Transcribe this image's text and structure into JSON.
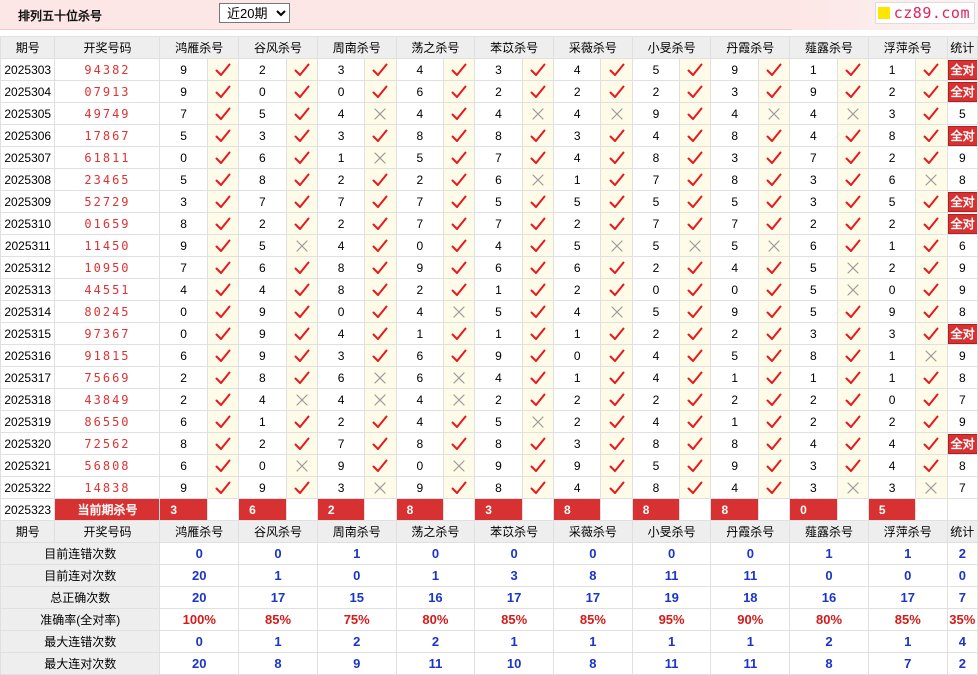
{
  "header": {
    "title": "排列五十位杀号",
    "range_selected": "近20期",
    "logo_text": "cz89.com"
  },
  "columns": {
    "period": "期号",
    "numbers": "开奖号码",
    "experts": [
      "鸿雁杀号",
      "谷风杀号",
      "周南杀号",
      "荡之杀号",
      "苯苡杀号",
      "采薇杀号",
      "小旻杀号",
      "丹霞杀号",
      "薤露杀号",
      "浮萍杀号"
    ],
    "stats": "统计"
  },
  "rows": [
    {
      "period": "2025303",
      "numbers": "94382",
      "kills": [
        9,
        2,
        3,
        4,
        3,
        4,
        5,
        9,
        1,
        1
      ],
      "ok": [
        1,
        1,
        1,
        1,
        1,
        1,
        1,
        1,
        1,
        1
      ],
      "stat": "全对"
    },
    {
      "period": "2025304",
      "numbers": "07913",
      "kills": [
        9,
        0,
        0,
        6,
        2,
        2,
        2,
        3,
        9,
        2
      ],
      "ok": [
        1,
        1,
        1,
        1,
        1,
        1,
        1,
        1,
        1,
        1
      ],
      "stat": "全对"
    },
    {
      "period": "2025305",
      "numbers": "49749",
      "kills": [
        7,
        5,
        4,
        4,
        4,
        4,
        9,
        4,
        4,
        3
      ],
      "ok": [
        1,
        1,
        0,
        1,
        0,
        0,
        1,
        0,
        0,
        1
      ],
      "stat": "5"
    },
    {
      "period": "2025306",
      "numbers": "17867",
      "kills": [
        5,
        3,
        3,
        8,
        8,
        3,
        4,
        8,
        4,
        8
      ],
      "ok": [
        1,
        1,
        1,
        1,
        1,
        1,
        1,
        1,
        1,
        1
      ],
      "stat": "全对"
    },
    {
      "period": "2025307",
      "numbers": "61811",
      "kills": [
        0,
        6,
        1,
        5,
        7,
        4,
        8,
        3,
        7,
        2
      ],
      "ok": [
        1,
        1,
        0,
        1,
        1,
        1,
        1,
        1,
        1,
        1
      ],
      "stat": "9"
    },
    {
      "period": "2025308",
      "numbers": "23465",
      "kills": [
        5,
        8,
        2,
        2,
        6,
        1,
        7,
        8,
        3,
        6
      ],
      "ok": [
        1,
        1,
        1,
        1,
        0,
        1,
        1,
        1,
        1,
        0
      ],
      "stat": "8"
    },
    {
      "period": "2025309",
      "numbers": "52729",
      "kills": [
        3,
        7,
        7,
        7,
        5,
        5,
        5,
        5,
        3,
        5
      ],
      "ok": [
        1,
        1,
        1,
        1,
        1,
        1,
        1,
        1,
        1,
        1
      ],
      "stat": "全对"
    },
    {
      "period": "2025310",
      "numbers": "01659",
      "kills": [
        8,
        2,
        2,
        7,
        7,
        2,
        7,
        7,
        2,
        2
      ],
      "ok": [
        1,
        1,
        1,
        1,
        1,
        1,
        1,
        1,
        1,
        1
      ],
      "stat": "全对"
    },
    {
      "period": "2025311",
      "numbers": "11450",
      "kills": [
        9,
        5,
        4,
        0,
        4,
        5,
        5,
        5,
        6,
        1
      ],
      "ok": [
        1,
        0,
        1,
        1,
        1,
        0,
        0,
        0,
        1,
        1
      ],
      "stat": "6"
    },
    {
      "period": "2025312",
      "numbers": "10950",
      "kills": [
        7,
        6,
        8,
        9,
        6,
        6,
        2,
        4,
        5,
        2
      ],
      "ok": [
        1,
        1,
        1,
        1,
        1,
        1,
        1,
        1,
        0,
        1
      ],
      "stat": "9"
    },
    {
      "period": "2025313",
      "numbers": "44551",
      "kills": [
        4,
        4,
        8,
        2,
        1,
        2,
        0,
        0,
        5,
        0
      ],
      "ok": [
        1,
        1,
        1,
        1,
        1,
        1,
        1,
        1,
        0,
        1
      ],
      "stat": "9"
    },
    {
      "period": "2025314",
      "numbers": "80245",
      "kills": [
        0,
        9,
        0,
        4,
        5,
        4,
        5,
        9,
        5,
        9
      ],
      "ok": [
        1,
        1,
        1,
        0,
        1,
        0,
        1,
        1,
        1,
        1
      ],
      "stat": "8"
    },
    {
      "period": "2025315",
      "numbers": "97367",
      "kills": [
        0,
        9,
        4,
        1,
        1,
        1,
        2,
        2,
        3,
        3
      ],
      "ok": [
        1,
        1,
        1,
        1,
        1,
        1,
        1,
        1,
        1,
        1
      ],
      "stat": "全对"
    },
    {
      "period": "2025316",
      "numbers": "91815",
      "kills": [
        6,
        9,
        3,
        6,
        9,
        0,
        4,
        5,
        8,
        1
      ],
      "ok": [
        1,
        1,
        1,
        1,
        1,
        1,
        1,
        1,
        1,
        0
      ],
      "stat": "9"
    },
    {
      "period": "2025317",
      "numbers": "75669",
      "kills": [
        2,
        8,
        6,
        6,
        4,
        1,
        4,
        1,
        1,
        1
      ],
      "ok": [
        1,
        1,
        0,
        0,
        1,
        1,
        1,
        1,
        1,
        1
      ],
      "stat": "8"
    },
    {
      "period": "2025318",
      "numbers": "43849",
      "kills": [
        2,
        4,
        4,
        4,
        2,
        2,
        2,
        2,
        2,
        0
      ],
      "ok": [
        1,
        0,
        0,
        0,
        1,
        1,
        1,
        1,
        1,
        1
      ],
      "stat": "7"
    },
    {
      "period": "2025319",
      "numbers": "86550",
      "kills": [
        6,
        1,
        2,
        4,
        5,
        2,
        4,
        1,
        2,
        2
      ],
      "ok": [
        1,
        1,
        1,
        1,
        0,
        1,
        1,
        1,
        1,
        1
      ],
      "stat": "9"
    },
    {
      "period": "2025320",
      "numbers": "72562",
      "kills": [
        8,
        2,
        7,
        8,
        8,
        3,
        8,
        8,
        4,
        4
      ],
      "ok": [
        1,
        1,
        1,
        1,
        1,
        1,
        1,
        1,
        1,
        1
      ],
      "stat": "全对"
    },
    {
      "period": "2025321",
      "numbers": "56808",
      "kills": [
        6,
        0,
        9,
        0,
        9,
        9,
        5,
        9,
        3,
        4
      ],
      "ok": [
        1,
        0,
        1,
        0,
        1,
        1,
        1,
        1,
        1,
        1
      ],
      "stat": "8"
    },
    {
      "period": "2025322",
      "numbers": "14838",
      "kills": [
        9,
        9,
        3,
        9,
        8,
        4,
        8,
        4,
        3,
        3
      ],
      "ok": [
        1,
        1,
        0,
        1,
        1,
        1,
        1,
        1,
        0,
        0
      ],
      "stat": "7"
    }
  ],
  "current": {
    "period": "2025323",
    "label": "当前期杀号",
    "kills": [
      3,
      6,
      2,
      8,
      3,
      8,
      8,
      8,
      0,
      5
    ]
  },
  "summary": [
    {
      "label": "目前连错次数",
      "values": [
        "0",
        "0",
        "1",
        "0",
        "0",
        "0",
        "0",
        "0",
        "1",
        "1"
      ],
      "stat": "2"
    },
    {
      "label": "目前连对次数",
      "values": [
        "20",
        "1",
        "0",
        "1",
        "3",
        "8",
        "11",
        "11",
        "0",
        "0"
      ],
      "stat": "0"
    },
    {
      "label": "总正确次数",
      "values": [
        "20",
        "17",
        "15",
        "16",
        "17",
        "17",
        "19",
        "18",
        "16",
        "17"
      ],
      "stat": "7"
    },
    {
      "label": "准确率(全对率)",
      "values": [
        "100%",
        "85%",
        "75%",
        "80%",
        "85%",
        "85%",
        "95%",
        "90%",
        "80%",
        "85%"
      ],
      "stat": "35%",
      "rate": true
    },
    {
      "label": "最大连错次数",
      "values": [
        "0",
        "1",
        "2",
        "2",
        "1",
        "1",
        "1",
        "1",
        "2",
        "1"
      ],
      "stat": "4"
    },
    {
      "label": "最大连对次数",
      "values": [
        "20",
        "8",
        "9",
        "11",
        "10",
        "8",
        "11",
        "11",
        "8",
        "7"
      ],
      "stat": "2"
    }
  ]
}
